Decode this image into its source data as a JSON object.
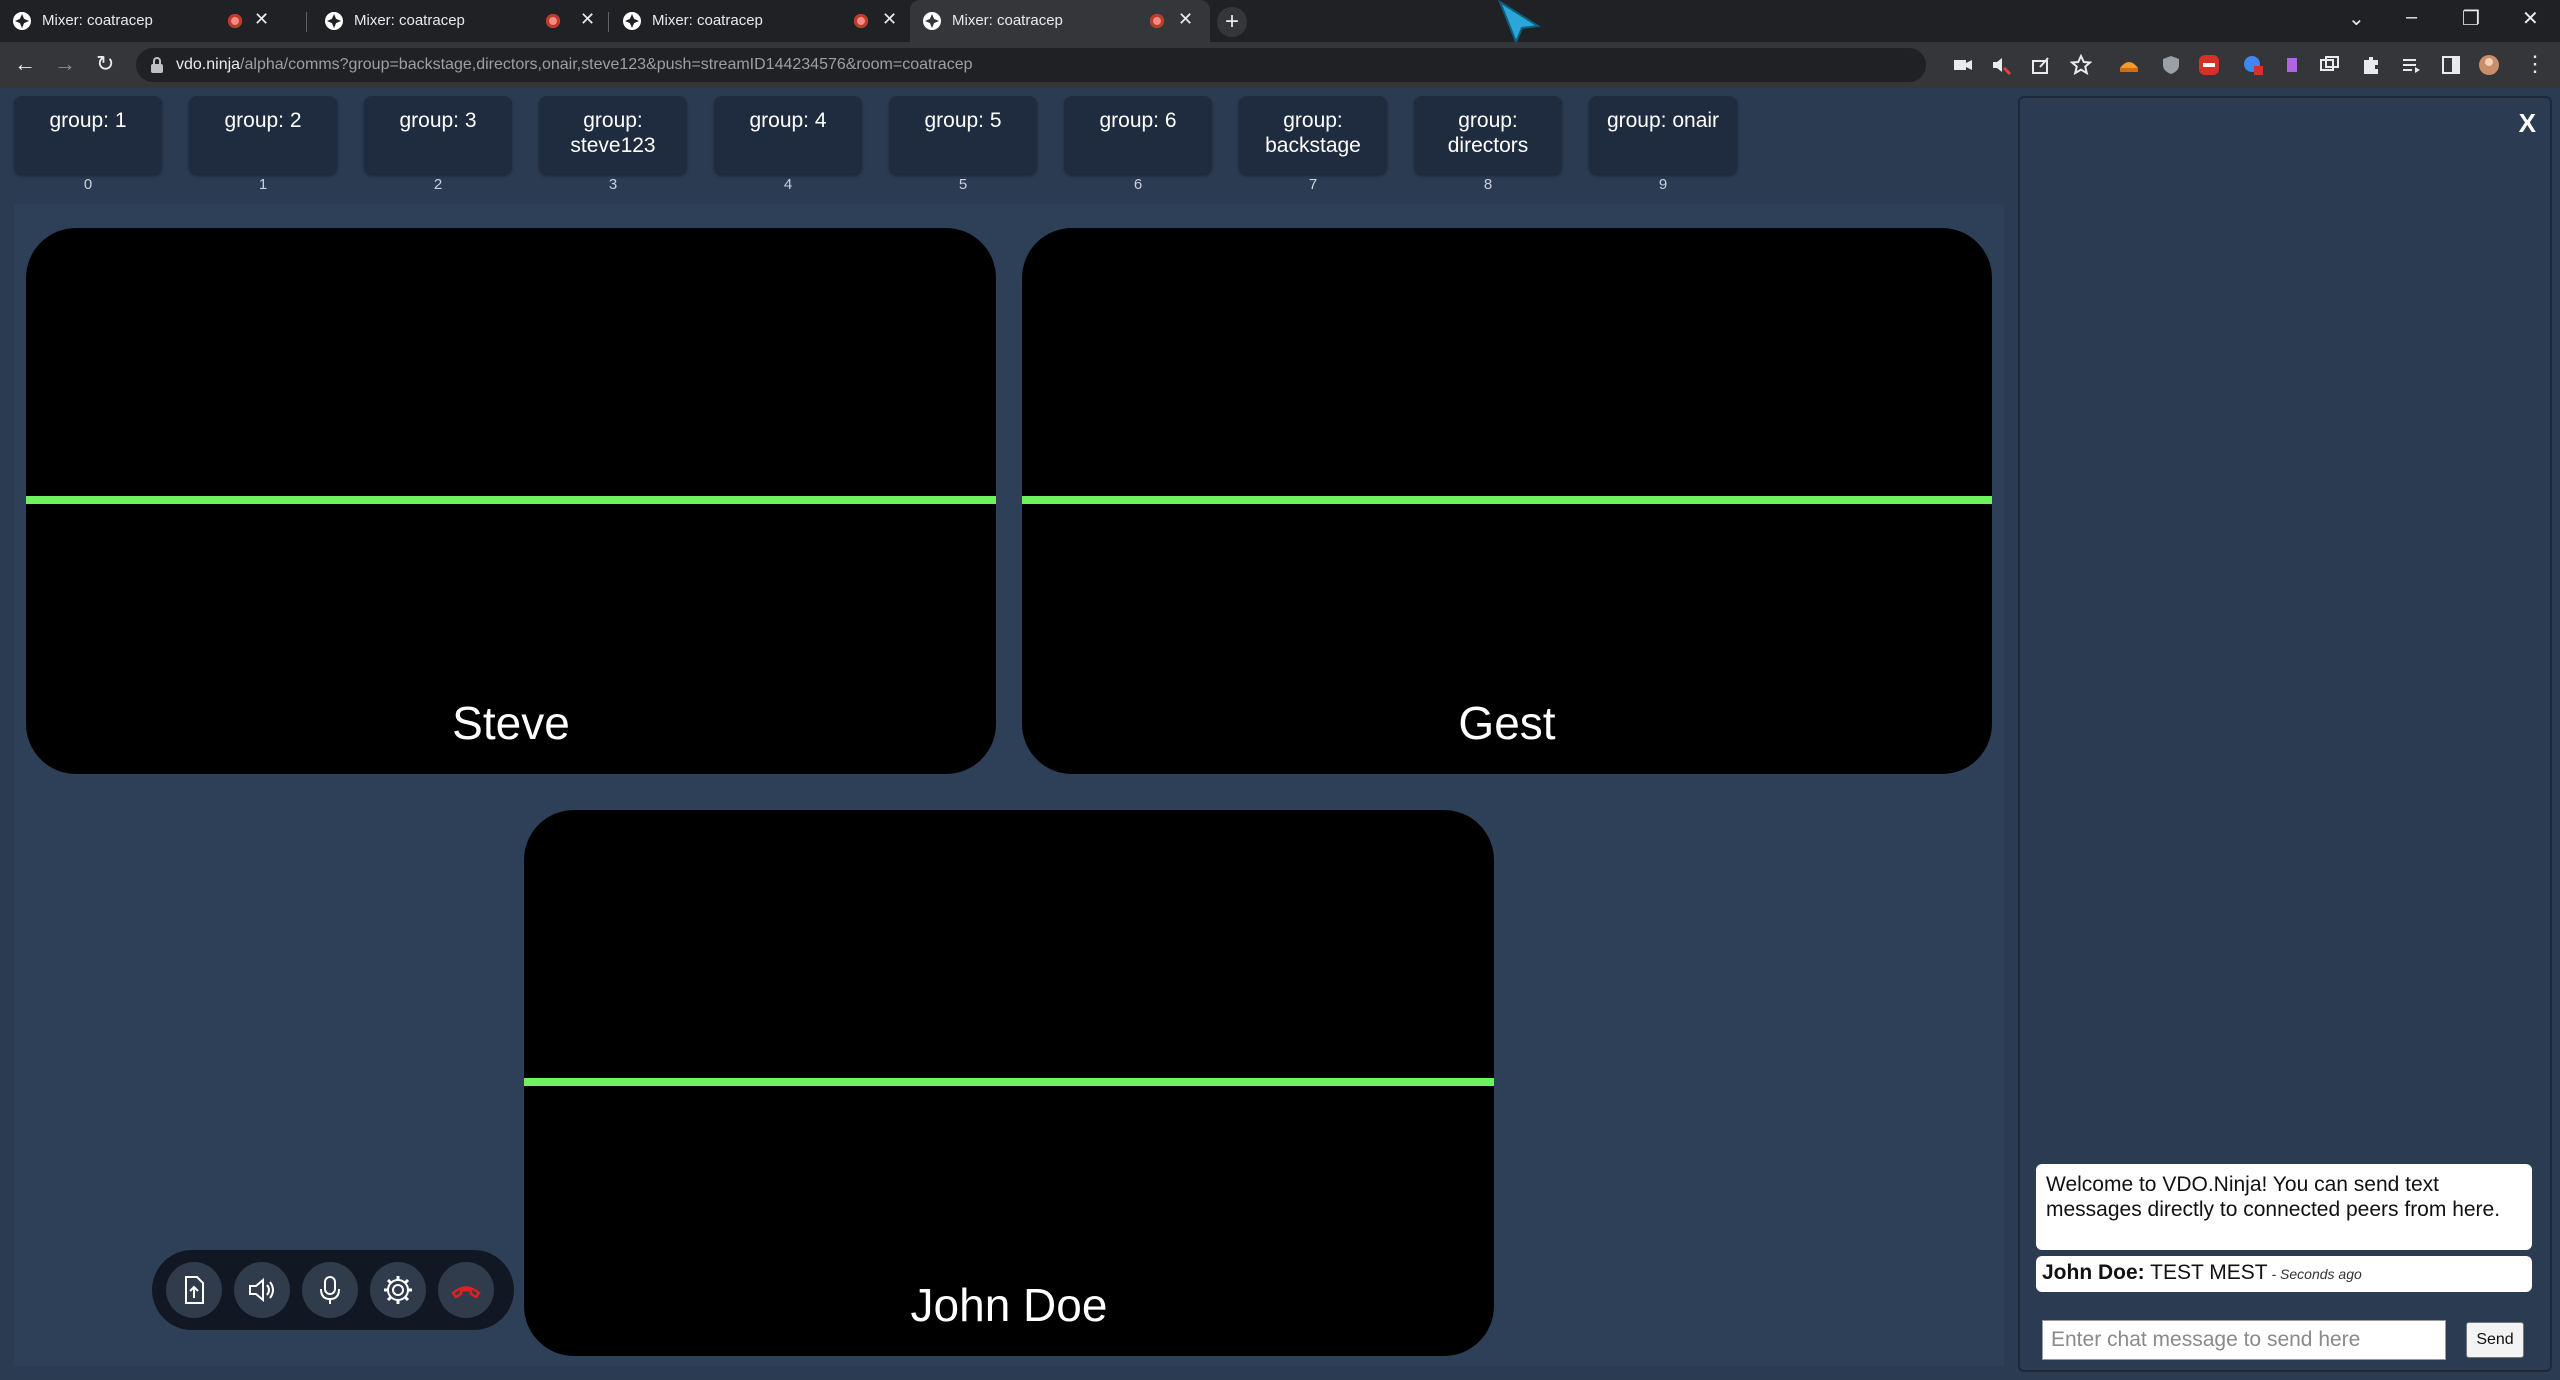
{
  "browser": {
    "tabs": [
      {
        "title": "Mixer: coatracep",
        "active": false
      },
      {
        "title": "Mixer: coatracep",
        "active": false
      },
      {
        "title": "Mixer: coatracep",
        "active": false
      },
      {
        "title": "Mixer: coatracep",
        "active": true
      }
    ],
    "url_host": "vdo.ninja",
    "url_rest": "/alpha/comms?group=backstage,directors,onair,steve123&push=streamID144234576&room=coatracep"
  },
  "groups": [
    {
      "label": "group: 1",
      "index": "0"
    },
    {
      "label": "group: 2",
      "index": "1"
    },
    {
      "label": "group: 3",
      "index": "2"
    },
    {
      "label": "group: steve123",
      "index": "3"
    },
    {
      "label": "group: 4",
      "index": "4"
    },
    {
      "label": "group: 5",
      "index": "5"
    },
    {
      "label": "group: 6",
      "index": "6"
    },
    {
      "label": "group: backstage",
      "index": "7"
    },
    {
      "label": "group: directors",
      "index": "8"
    },
    {
      "label": "group: onair",
      "index": "9"
    }
  ],
  "tiles": [
    {
      "name": "Steve"
    },
    {
      "name": "Gest"
    },
    {
      "name": "John Doe"
    }
  ],
  "controls": [
    "share-screen-icon",
    "speaker-icon",
    "microphone-icon",
    "settings-icon",
    "hangup-icon"
  ],
  "chat": {
    "close_label": "X",
    "welcome": "Welcome to VDO.Ninja! You can send text messages directly to connected peers from here.",
    "messages": [
      {
        "sender": "John Doe:",
        "text": " TEST MEST",
        "time": " - Seconds ago"
      }
    ],
    "input_placeholder": "Enter chat message to send here",
    "send_label": "Send"
  },
  "colors": {
    "background": "#2b3b52",
    "audio_meter": "#6cf35e",
    "hangup": "#e02020"
  }
}
